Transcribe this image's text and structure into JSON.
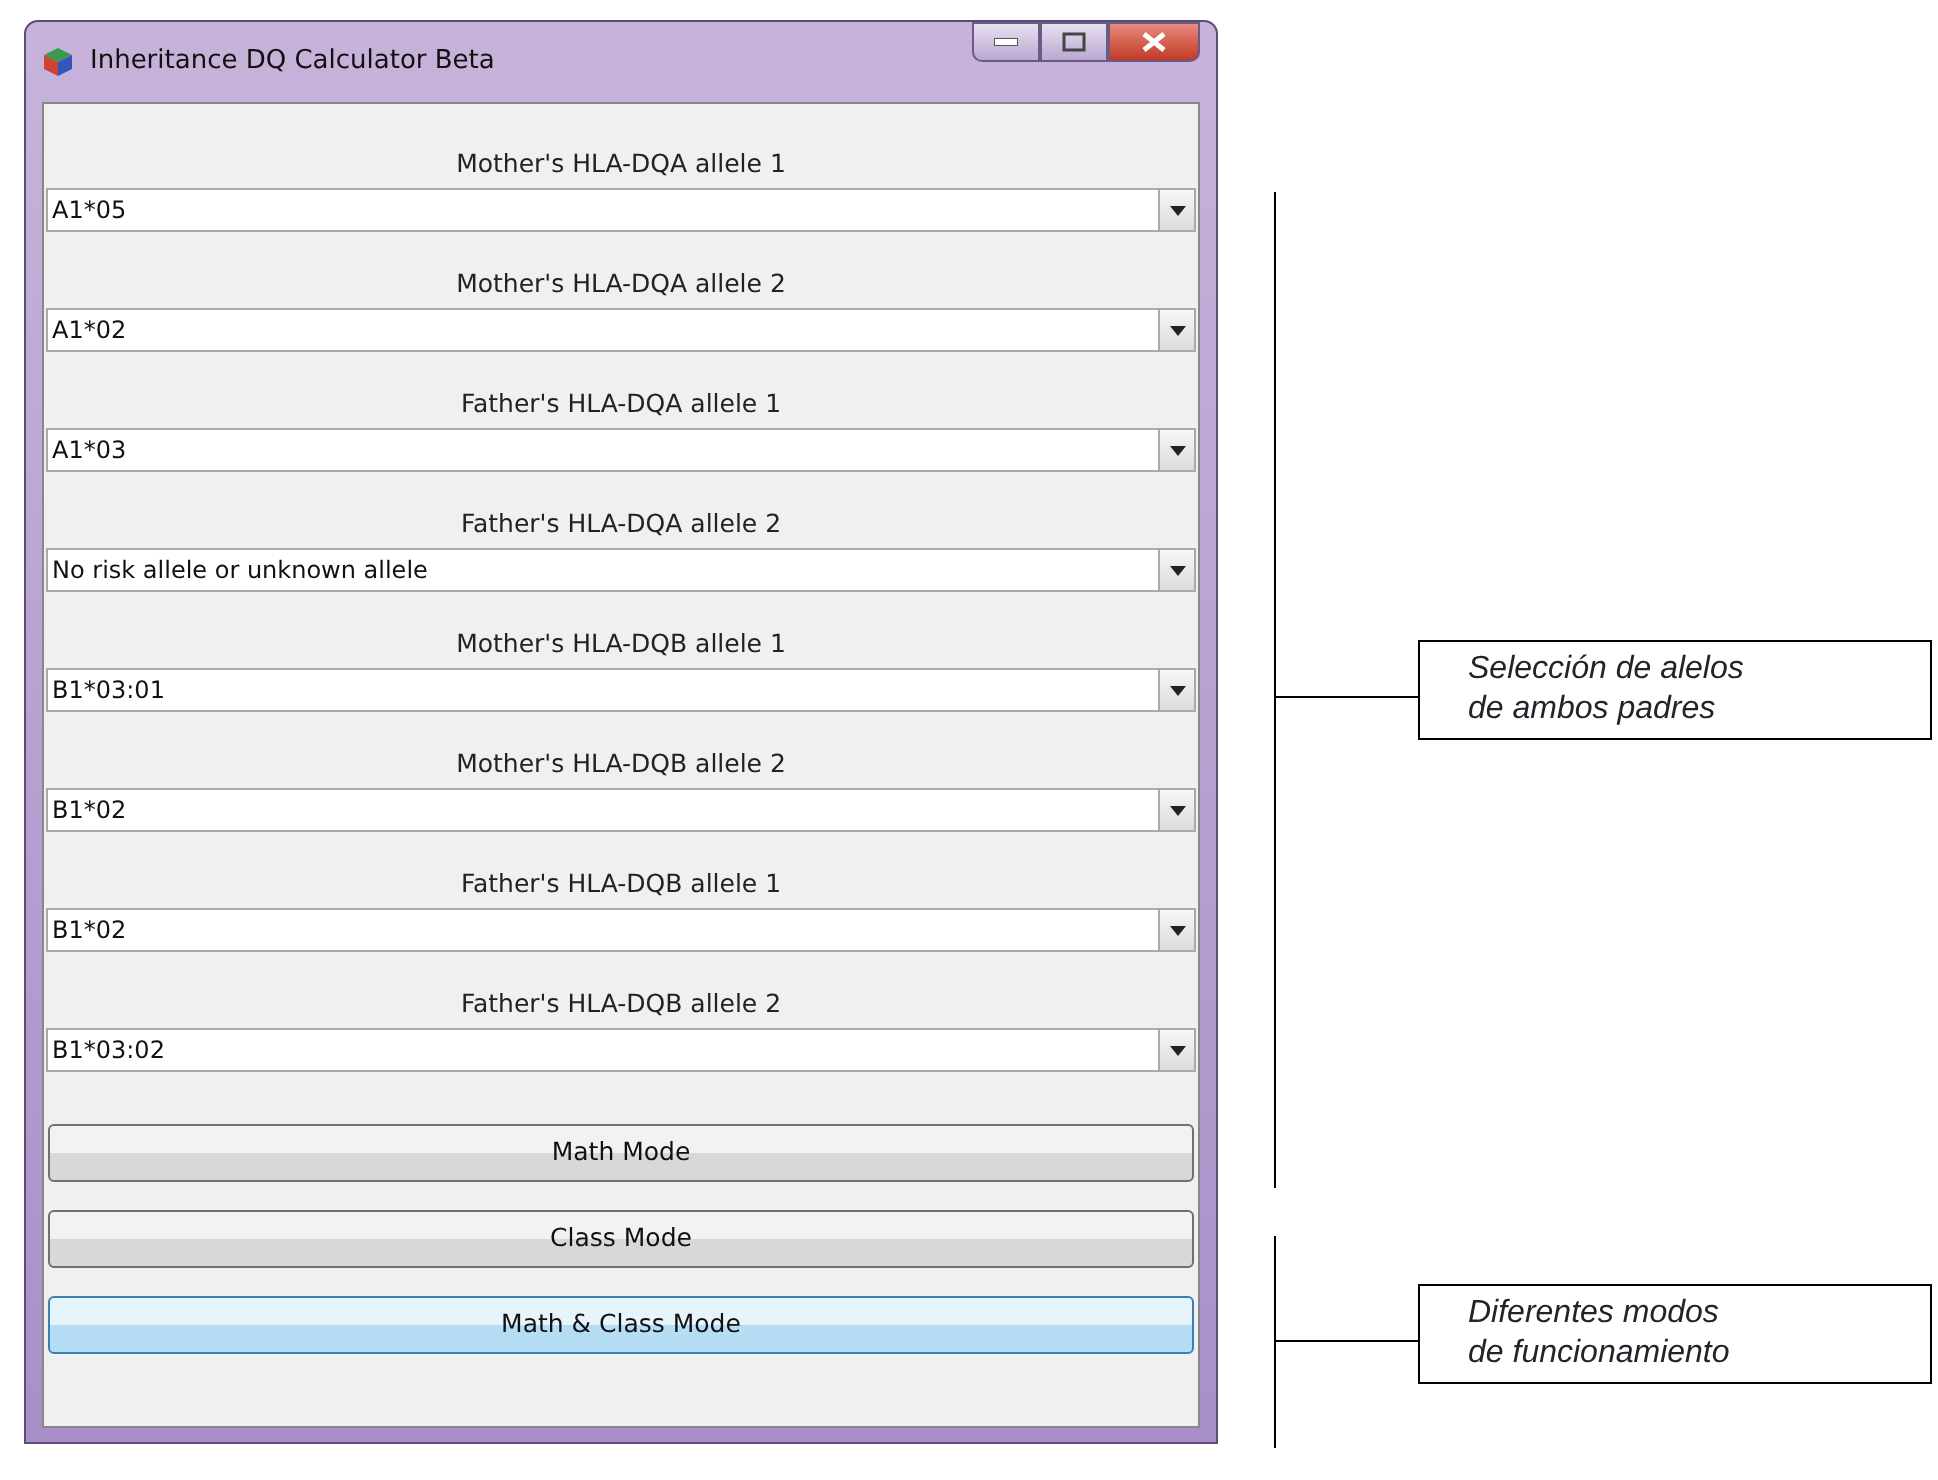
{
  "window": {
    "title": "Inheritance DQ Calculator Beta"
  },
  "fields": [
    {
      "label": "Mother's HLA-DQA allele 1",
      "value": "A1*05"
    },
    {
      "label": "Mother's HLA-DQA allele 2",
      "value": "A1*02"
    },
    {
      "label": "Father's HLA-DQA allele 1",
      "value": "A1*03"
    },
    {
      "label": "Father's HLA-DQA allele 2",
      "value": "No risk allele or unknown allele"
    },
    {
      "label": "Mother's HLA-DQB allele 1",
      "value": "B1*03:01"
    },
    {
      "label": "Mother's HLA-DQB allele 2",
      "value": "B1*02"
    },
    {
      "label": "Father's HLA-DQB allele 1",
      "value": "B1*02"
    },
    {
      "label": "Father's HLA-DQB allele 2",
      "value": "B1*03:02"
    }
  ],
  "buttons": [
    {
      "label": "Math Mode",
      "hovered": false
    },
    {
      "label": "Class Mode",
      "hovered": false
    },
    {
      "label": "Math & Class Mode",
      "hovered": true
    }
  ],
  "annotations": [
    {
      "text": "Selección de alelos\nde ambos padres"
    },
    {
      "text": "Diferentes modos\nde funcionamiento"
    }
  ]
}
